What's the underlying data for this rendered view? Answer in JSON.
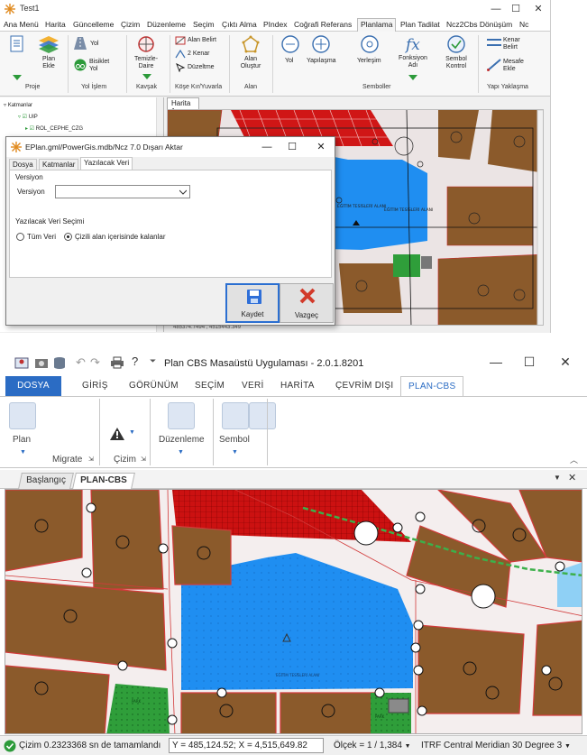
{
  "top_app": {
    "title": "Test1",
    "window_controls": {
      "minimize": "—",
      "maximize": "☐",
      "close": "✕"
    },
    "menu": [
      "Ana Menü",
      "Harita",
      "Güncelleme",
      "Çizim",
      "Düzenleme",
      "Seçim",
      "Çıktı Alma",
      "PIndex",
      "Coğrafi Referans",
      "Planlama",
      "Plan Tadilat",
      "Ncz2Cbs Dönüşüm",
      "Nc"
    ],
    "active_menu": "Planlama",
    "ribbon": {
      "proje": {
        "group": "Proje",
        "plan_ekle": "Plan\nEkle"
      },
      "yol_islem": {
        "group": "Yol İşlem",
        "yol": "Yol",
        "bisiklet_yol": "Bisiklet\nYol"
      },
      "kavsak": {
        "group": "Kavşak",
        "temizle_daire": "Temizle-\nDaire"
      },
      "kose": {
        "group": "Köşe Kır/Yuvarla",
        "alan_belirt": "Alan Belirt",
        "iki_kenar": "2 Kenar",
        "duzeltme": "Düzeltme"
      },
      "alan": {
        "group": "Alan",
        "alan_olustur": "Alan\nOluştur"
      },
      "semboller": {
        "group": "Semboller",
        "yol": "Yol",
        "yapilasma": "Yapılaşma",
        "yerlesim": "Yerleşim",
        "fonksiyon_adi": "Fonksiyon\nAdı",
        "sembol_kontrol": "Sembol\nKontrol"
      },
      "yapi_yaklasma": {
        "group": "Yapı Yaklaşma",
        "kenar_belirt": "Kenar\nBelirt",
        "mesafe_ekle": "Mesafe\nEkle"
      }
    },
    "layers_panel": {
      "root": "Katmanlar",
      "item1": "UIP",
      "item2": "ROL_CEPHE_CZG"
    },
    "map_tab": "Harita 1",
    "map_labels": {
      "area": "EĞİTİM TESİSLERİ ALANI",
      "area2": "EĞİTİM TESİSLERİ ALANI"
    },
    "coord_text": "485374.7494 , 4515443.349",
    "dialog": {
      "title": "EPlan.gml/PowerGis.mdb/Ncz 7.0 Dışarı Aktar",
      "tabs": [
        "Dosya",
        "Katmanlar",
        "Yazılacak Veri"
      ],
      "active_tab": "Yazılacak Veri",
      "section_version": "Versiyon",
      "version_label": "Versiyon",
      "version_value": "",
      "section_data": "Yazılacak Veri Seçimi",
      "radio_all": "Tüm Veri",
      "radio_inside": "Çizili alan içerisinde kalanlar",
      "selected_radio": "inside",
      "save_button": "Kaydet",
      "cancel_button": "Vazgeç"
    }
  },
  "bottom_app": {
    "title": "Plan CBS Masaüstü Uygulaması - 2.0.1.8201",
    "window_controls": {
      "minimize": "—",
      "maximize": "☐",
      "close": "✕"
    },
    "tabs": [
      "DOSYA",
      "GİRİŞ",
      "GÖRÜNÜM",
      "SEÇİM",
      "VERİ",
      "HARİTA",
      "ÇEVRİM DIŞI",
      "PLAN-CBS"
    ],
    "active_tab": "PLAN-CBS",
    "ribbon": {
      "plan": "Plan",
      "migrate": "Migrate",
      "cizim": "Çizim",
      "duzenleme": "Düzenleme",
      "sembol": "Sembol"
    },
    "doc_tabs": [
      "Başlangıç",
      "PLAN-CBS"
    ],
    "active_doc_tab": "PLAN-CBS",
    "map_labels": {
      "area": "EĞİTİM TESİSLERİ ALANI",
      "park1": "PARK",
      "park2": "PARK"
    },
    "status": {
      "message": "Çizim 0.2323368 sn de tamamlandı",
      "coords": "Y = 485,124.52; X = 4,515,649.82",
      "scale": "Ölçek = 1 / 1,384",
      "crs": "ITRF Central Meridian 30 Degree 3"
    }
  },
  "colors": {
    "brown_parcel": "#8b5a2b",
    "blue_area": "#1f8ef1",
    "red_area": "#cc1111",
    "green_area": "#2f9e3a",
    "road": "#f1ecec",
    "accent": "#2b6cc4"
  }
}
